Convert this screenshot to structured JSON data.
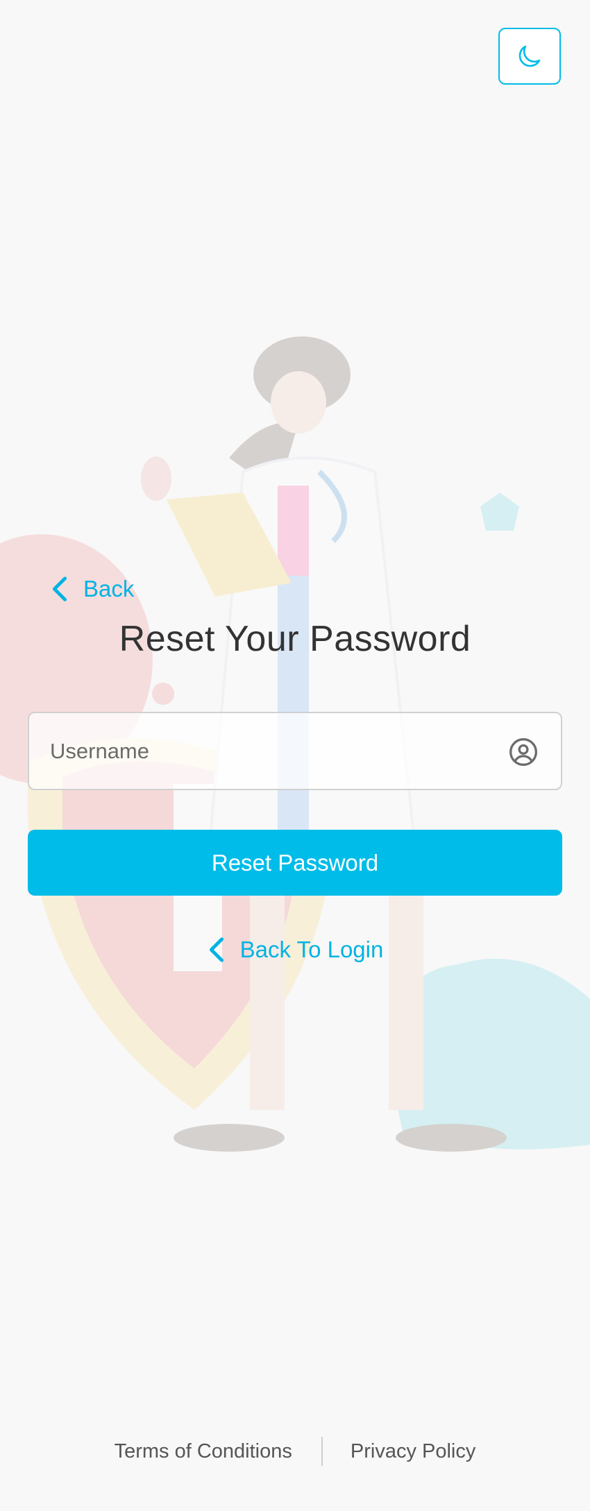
{
  "header": {
    "theme_toggle_icon": "moon-icon"
  },
  "nav": {
    "back_label": "Back",
    "back_icon": "chevron-left-icon"
  },
  "page": {
    "title": "Reset Your Password"
  },
  "form": {
    "username": {
      "placeholder": "Username",
      "value": "",
      "icon": "user-circle-icon"
    },
    "submit_label": "Reset Password"
  },
  "back_to_login": {
    "label": "Back To Login",
    "icon": "chevron-left-icon"
  },
  "footer": {
    "terms_label": "Terms of Conditions",
    "privacy_label": "Privacy Policy"
  },
  "colors": {
    "accent": "#00bce8",
    "link": "#00b3e3",
    "background": "#f8f8f8",
    "text": "#333333",
    "muted_text": "#555555"
  }
}
